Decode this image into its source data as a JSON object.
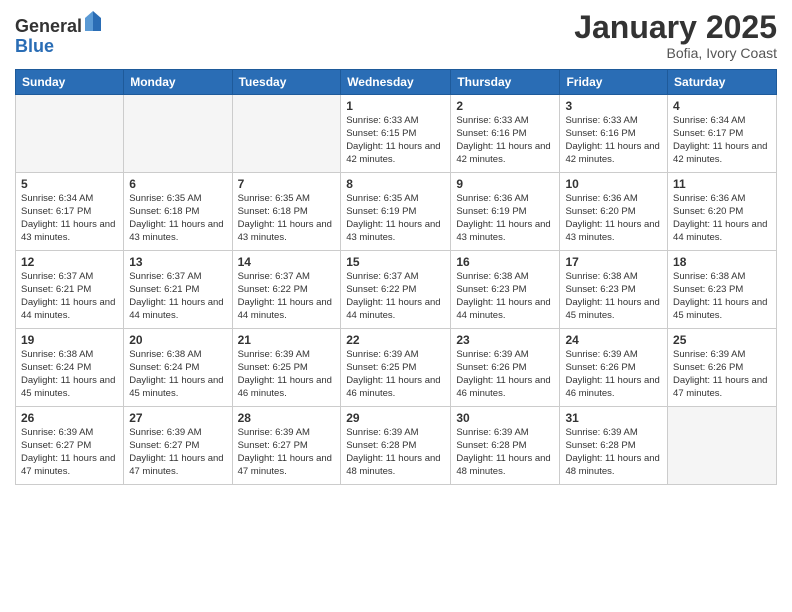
{
  "header": {
    "logo_line1": "General",
    "logo_line2": "Blue",
    "month_title": "January 2025",
    "location": "Bofia, Ivory Coast"
  },
  "days_of_week": [
    "Sunday",
    "Monday",
    "Tuesday",
    "Wednesday",
    "Thursday",
    "Friday",
    "Saturday"
  ],
  "weeks": [
    [
      {
        "day": "",
        "sunrise": "",
        "sunset": "",
        "daylight": ""
      },
      {
        "day": "",
        "sunrise": "",
        "sunset": "",
        "daylight": ""
      },
      {
        "day": "",
        "sunrise": "",
        "sunset": "",
        "daylight": ""
      },
      {
        "day": "1",
        "sunrise": "Sunrise: 6:33 AM",
        "sunset": "Sunset: 6:15 PM",
        "daylight": "Daylight: 11 hours and 42 minutes."
      },
      {
        "day": "2",
        "sunrise": "Sunrise: 6:33 AM",
        "sunset": "Sunset: 6:16 PM",
        "daylight": "Daylight: 11 hours and 42 minutes."
      },
      {
        "day": "3",
        "sunrise": "Sunrise: 6:33 AM",
        "sunset": "Sunset: 6:16 PM",
        "daylight": "Daylight: 11 hours and 42 minutes."
      },
      {
        "day": "4",
        "sunrise": "Sunrise: 6:34 AM",
        "sunset": "Sunset: 6:17 PM",
        "daylight": "Daylight: 11 hours and 42 minutes."
      }
    ],
    [
      {
        "day": "5",
        "sunrise": "Sunrise: 6:34 AM",
        "sunset": "Sunset: 6:17 PM",
        "daylight": "Daylight: 11 hours and 43 minutes."
      },
      {
        "day": "6",
        "sunrise": "Sunrise: 6:35 AM",
        "sunset": "Sunset: 6:18 PM",
        "daylight": "Daylight: 11 hours and 43 minutes."
      },
      {
        "day": "7",
        "sunrise": "Sunrise: 6:35 AM",
        "sunset": "Sunset: 6:18 PM",
        "daylight": "Daylight: 11 hours and 43 minutes."
      },
      {
        "day": "8",
        "sunrise": "Sunrise: 6:35 AM",
        "sunset": "Sunset: 6:19 PM",
        "daylight": "Daylight: 11 hours and 43 minutes."
      },
      {
        "day": "9",
        "sunrise": "Sunrise: 6:36 AM",
        "sunset": "Sunset: 6:19 PM",
        "daylight": "Daylight: 11 hours and 43 minutes."
      },
      {
        "day": "10",
        "sunrise": "Sunrise: 6:36 AM",
        "sunset": "Sunset: 6:20 PM",
        "daylight": "Daylight: 11 hours and 43 minutes."
      },
      {
        "day": "11",
        "sunrise": "Sunrise: 6:36 AM",
        "sunset": "Sunset: 6:20 PM",
        "daylight": "Daylight: 11 hours and 44 minutes."
      }
    ],
    [
      {
        "day": "12",
        "sunrise": "Sunrise: 6:37 AM",
        "sunset": "Sunset: 6:21 PM",
        "daylight": "Daylight: 11 hours and 44 minutes."
      },
      {
        "day": "13",
        "sunrise": "Sunrise: 6:37 AM",
        "sunset": "Sunset: 6:21 PM",
        "daylight": "Daylight: 11 hours and 44 minutes."
      },
      {
        "day": "14",
        "sunrise": "Sunrise: 6:37 AM",
        "sunset": "Sunset: 6:22 PM",
        "daylight": "Daylight: 11 hours and 44 minutes."
      },
      {
        "day": "15",
        "sunrise": "Sunrise: 6:37 AM",
        "sunset": "Sunset: 6:22 PM",
        "daylight": "Daylight: 11 hours and 44 minutes."
      },
      {
        "day": "16",
        "sunrise": "Sunrise: 6:38 AM",
        "sunset": "Sunset: 6:23 PM",
        "daylight": "Daylight: 11 hours and 44 minutes."
      },
      {
        "day": "17",
        "sunrise": "Sunrise: 6:38 AM",
        "sunset": "Sunset: 6:23 PM",
        "daylight": "Daylight: 11 hours and 45 minutes."
      },
      {
        "day": "18",
        "sunrise": "Sunrise: 6:38 AM",
        "sunset": "Sunset: 6:23 PM",
        "daylight": "Daylight: 11 hours and 45 minutes."
      }
    ],
    [
      {
        "day": "19",
        "sunrise": "Sunrise: 6:38 AM",
        "sunset": "Sunset: 6:24 PM",
        "daylight": "Daylight: 11 hours and 45 minutes."
      },
      {
        "day": "20",
        "sunrise": "Sunrise: 6:38 AM",
        "sunset": "Sunset: 6:24 PM",
        "daylight": "Daylight: 11 hours and 45 minutes."
      },
      {
        "day": "21",
        "sunrise": "Sunrise: 6:39 AM",
        "sunset": "Sunset: 6:25 PM",
        "daylight": "Daylight: 11 hours and 46 minutes."
      },
      {
        "day": "22",
        "sunrise": "Sunrise: 6:39 AM",
        "sunset": "Sunset: 6:25 PM",
        "daylight": "Daylight: 11 hours and 46 minutes."
      },
      {
        "day": "23",
        "sunrise": "Sunrise: 6:39 AM",
        "sunset": "Sunset: 6:26 PM",
        "daylight": "Daylight: 11 hours and 46 minutes."
      },
      {
        "day": "24",
        "sunrise": "Sunrise: 6:39 AM",
        "sunset": "Sunset: 6:26 PM",
        "daylight": "Daylight: 11 hours and 46 minutes."
      },
      {
        "day": "25",
        "sunrise": "Sunrise: 6:39 AM",
        "sunset": "Sunset: 6:26 PM",
        "daylight": "Daylight: 11 hours and 47 minutes."
      }
    ],
    [
      {
        "day": "26",
        "sunrise": "Sunrise: 6:39 AM",
        "sunset": "Sunset: 6:27 PM",
        "daylight": "Daylight: 11 hours and 47 minutes."
      },
      {
        "day": "27",
        "sunrise": "Sunrise: 6:39 AM",
        "sunset": "Sunset: 6:27 PM",
        "daylight": "Daylight: 11 hours and 47 minutes."
      },
      {
        "day": "28",
        "sunrise": "Sunrise: 6:39 AM",
        "sunset": "Sunset: 6:27 PM",
        "daylight": "Daylight: 11 hours and 47 minutes."
      },
      {
        "day": "29",
        "sunrise": "Sunrise: 6:39 AM",
        "sunset": "Sunset: 6:28 PM",
        "daylight": "Daylight: 11 hours and 48 minutes."
      },
      {
        "day": "30",
        "sunrise": "Sunrise: 6:39 AM",
        "sunset": "Sunset: 6:28 PM",
        "daylight": "Daylight: 11 hours and 48 minutes."
      },
      {
        "day": "31",
        "sunrise": "Sunrise: 6:39 AM",
        "sunset": "Sunset: 6:28 PM",
        "daylight": "Daylight: 11 hours and 48 minutes."
      },
      {
        "day": "",
        "sunrise": "",
        "sunset": "",
        "daylight": ""
      }
    ]
  ],
  "colors": {
    "header_bg": "#2a6db5",
    "header_text": "#ffffff",
    "border": "#cccccc",
    "empty_cell": "#f5f5f5"
  }
}
